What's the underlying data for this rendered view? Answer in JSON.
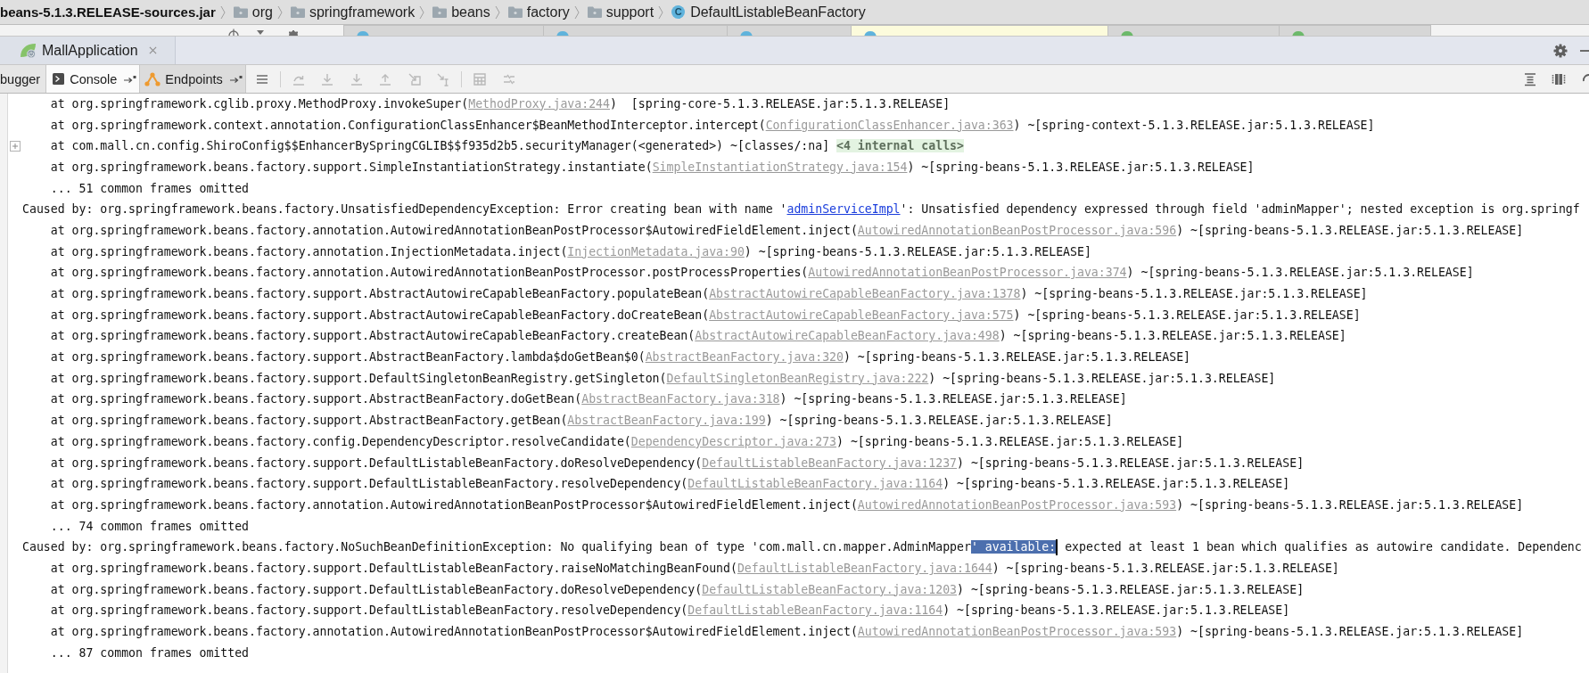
{
  "breadcrumb": {
    "items": [
      {
        "kind": "jar",
        "label": "beans-5.1.3.RELEASE-sources.jar"
      },
      {
        "kind": "folder",
        "label": "org"
      },
      {
        "kind": "folder",
        "label": "springframework"
      },
      {
        "kind": "folder",
        "label": "beans"
      },
      {
        "kind": "folder",
        "label": "factory"
      },
      {
        "kind": "folder",
        "label": "support"
      },
      {
        "kind": "class",
        "icon_letter": "C",
        "label": "DefaultListableBeanFactory"
      }
    ]
  },
  "editor_tabs": [
    {
      "selected": false,
      "color": "#5fb3dc"
    },
    {
      "selected": false,
      "color": "#5fb3dc"
    },
    {
      "selected": false,
      "color": "#5fb3dc"
    },
    {
      "selected": true,
      "color": "#5fb3dc"
    },
    {
      "selected": false,
      "color": "#6cb96a"
    },
    {
      "selected": false,
      "color": "#6cb96a"
    }
  ],
  "run_panel": {
    "tab": {
      "label": "MallApplication"
    }
  },
  "tool_tabs": [
    {
      "kind": "cut",
      "label": "bugger",
      "selected": false
    },
    {
      "kind": "console",
      "label": "Console",
      "selected": true
    },
    {
      "kind": "endpoints",
      "label": "Endpoints",
      "selected": false
    }
  ],
  "toolbar_groups": [
    [
      {
        "kind": "menu",
        "disabled": false
      }
    ],
    [
      {
        "kind": "curved_arrow",
        "disabled": true
      },
      {
        "kind": "down_arrow",
        "disabled": true
      },
      {
        "kind": "down_arrow",
        "disabled": true
      },
      {
        "kind": "up_arrow",
        "disabled": true
      },
      {
        "kind": "arrow_box",
        "disabled": true
      },
      {
        "kind": "arrow_cursor",
        "disabled": true
      }
    ],
    [
      {
        "kind": "calculator",
        "disabled": true
      },
      {
        "kind": "sliders",
        "disabled": true
      }
    ]
  ],
  "console": {
    "lines": [
      {
        "kind": "frame",
        "folded": false,
        "segments": [
          {
            "kind": "text",
            "text": "at org.springframework.cglib.proxy.MethodProxy.invokeSuper("
          },
          {
            "kind": "source_link",
            "text": "MethodProxy.java:244"
          },
          {
            "kind": "text",
            "text": ")  [spring-core-5.1.3.RELEASE.jar:5.1.3.RELEASE]"
          }
        ]
      },
      {
        "kind": "frame",
        "folded": false,
        "segments": [
          {
            "kind": "text",
            "text": "at org.springframework.context.annotation.ConfigurationClassEnhancer$BeanMethodInterceptor.intercept("
          },
          {
            "kind": "source_link",
            "text": "ConfigurationClassEnhancer.java:363"
          },
          {
            "kind": "text",
            "text": ") ~[spring-context-5.1.3.RELEASE.jar:5.1.3.RELEASE]"
          }
        ]
      },
      {
        "kind": "frame",
        "folded": true,
        "segments": [
          {
            "kind": "text",
            "text": "at com.mall.cn.config.ShiroConfig$$EnhancerBySpringCGLIB$$f935d2b5.securityManager(<generated>) ~[classes/:na] "
          },
          {
            "kind": "internal_calls",
            "text": "<4 internal calls>"
          }
        ]
      },
      {
        "kind": "frame",
        "folded": false,
        "segments": [
          {
            "kind": "text",
            "text": "at org.springframework.beans.factory.support.SimpleInstantiationStrategy.instantiate("
          },
          {
            "kind": "source_link",
            "text": "SimpleInstantiationStrategy.java:154"
          },
          {
            "kind": "text",
            "text": ") ~[spring-beans-5.1.3.RELEASE.jar:5.1.3.RELEASE]"
          }
        ]
      },
      {
        "kind": "omitted",
        "folded": false,
        "segments": [
          {
            "kind": "text",
            "text": "... 51 common frames omitted"
          }
        ]
      },
      {
        "kind": "caused_by",
        "folded": false,
        "segments": [
          {
            "kind": "text",
            "text": "Caused by: org.springframework.beans.factory.UnsatisfiedDependencyException: Error creating bean with name '"
          },
          {
            "kind": "bean_link",
            "text": "adminServiceImpl"
          },
          {
            "kind": "text",
            "text": "': Unsatisfied dependency expressed through field 'adminMapper'; nested exception is org.springf"
          }
        ]
      },
      {
        "kind": "frame",
        "folded": false,
        "segments": [
          {
            "kind": "text",
            "text": "at org.springframework.beans.factory.annotation.AutowiredAnnotationBeanPostProcessor$AutowiredFieldElement.inject("
          },
          {
            "kind": "source_link",
            "text": "AutowiredAnnotationBeanPostProcessor.java:596"
          },
          {
            "kind": "text",
            "text": ") ~[spring-beans-5.1.3.RELEASE.jar:5.1.3.RELEASE]"
          }
        ]
      },
      {
        "kind": "frame",
        "folded": false,
        "segments": [
          {
            "kind": "text",
            "text": "at org.springframework.beans.factory.annotation.InjectionMetadata.inject("
          },
          {
            "kind": "source_link",
            "text": "InjectionMetadata.java:90"
          },
          {
            "kind": "text",
            "text": ") ~[spring-beans-5.1.3.RELEASE.jar:5.1.3.RELEASE]"
          }
        ]
      },
      {
        "kind": "frame",
        "folded": false,
        "segments": [
          {
            "kind": "text",
            "text": "at org.springframework.beans.factory.annotation.AutowiredAnnotationBeanPostProcessor.postProcessProperties("
          },
          {
            "kind": "source_link",
            "text": "AutowiredAnnotationBeanPostProcessor.java:374"
          },
          {
            "kind": "text",
            "text": ") ~[spring-beans-5.1.3.RELEASE.jar:5.1.3.RELEASE]"
          }
        ]
      },
      {
        "kind": "frame",
        "folded": false,
        "segments": [
          {
            "kind": "text",
            "text": "at org.springframework.beans.factory.support.AbstractAutowireCapableBeanFactory.populateBean("
          },
          {
            "kind": "source_link",
            "text": "AbstractAutowireCapableBeanFactory.java:1378"
          },
          {
            "kind": "text",
            "text": ") ~[spring-beans-5.1.3.RELEASE.jar:5.1.3.RELEASE]"
          }
        ]
      },
      {
        "kind": "frame",
        "folded": false,
        "segments": [
          {
            "kind": "text",
            "text": "at org.springframework.beans.factory.support.AbstractAutowireCapableBeanFactory.doCreateBean("
          },
          {
            "kind": "source_link",
            "text": "AbstractAutowireCapableBeanFactory.java:575"
          },
          {
            "kind": "text",
            "text": ") ~[spring-beans-5.1.3.RELEASE.jar:5.1.3.RELEASE]"
          }
        ]
      },
      {
        "kind": "frame",
        "folded": false,
        "segments": [
          {
            "kind": "text",
            "text": "at org.springframework.beans.factory.support.AbstractAutowireCapableBeanFactory.createBean("
          },
          {
            "kind": "source_link",
            "text": "AbstractAutowireCapableBeanFactory.java:498"
          },
          {
            "kind": "text",
            "text": ") ~[spring-beans-5.1.3.RELEASE.jar:5.1.3.RELEASE]"
          }
        ]
      },
      {
        "kind": "frame",
        "folded": false,
        "segments": [
          {
            "kind": "text",
            "text": "at org.springframework.beans.factory.support.AbstractBeanFactory.lambda$doGetBean$0("
          },
          {
            "kind": "source_link",
            "text": "AbstractBeanFactory.java:320"
          },
          {
            "kind": "text",
            "text": ") ~[spring-beans-5.1.3.RELEASE.jar:5.1.3.RELEASE]"
          }
        ]
      },
      {
        "kind": "frame",
        "folded": false,
        "segments": [
          {
            "kind": "text",
            "text": "at org.springframework.beans.factory.support.DefaultSingletonBeanRegistry.getSingleton("
          },
          {
            "kind": "source_link",
            "text": "DefaultSingletonBeanRegistry.java:222"
          },
          {
            "kind": "text",
            "text": ") ~[spring-beans-5.1.3.RELEASE.jar:5.1.3.RELEASE]"
          }
        ]
      },
      {
        "kind": "frame",
        "folded": false,
        "segments": [
          {
            "kind": "text",
            "text": "at org.springframework.beans.factory.support.AbstractBeanFactory.doGetBean("
          },
          {
            "kind": "source_link",
            "text": "AbstractBeanFactory.java:318"
          },
          {
            "kind": "text",
            "text": ") ~[spring-beans-5.1.3.RELEASE.jar:5.1.3.RELEASE]"
          }
        ]
      },
      {
        "kind": "frame",
        "folded": false,
        "segments": [
          {
            "kind": "text",
            "text": "at org.springframework.beans.factory.support.AbstractBeanFactory.getBean("
          },
          {
            "kind": "source_link",
            "text": "AbstractBeanFactory.java:199"
          },
          {
            "kind": "text",
            "text": ") ~[spring-beans-5.1.3.RELEASE.jar:5.1.3.RELEASE]"
          }
        ]
      },
      {
        "kind": "frame",
        "folded": false,
        "segments": [
          {
            "kind": "text",
            "text": "at org.springframework.beans.factory.config.DependencyDescriptor.resolveCandidate("
          },
          {
            "kind": "source_link",
            "text": "DependencyDescriptor.java:273"
          },
          {
            "kind": "text",
            "text": ") ~[spring-beans-5.1.3.RELEASE.jar:5.1.3.RELEASE]"
          }
        ]
      },
      {
        "kind": "frame",
        "folded": false,
        "segments": [
          {
            "kind": "text",
            "text": "at org.springframework.beans.factory.support.DefaultListableBeanFactory.doResolveDependency("
          },
          {
            "kind": "source_link",
            "text": "DefaultListableBeanFactory.java:1237"
          },
          {
            "kind": "text",
            "text": ") ~[spring-beans-5.1.3.RELEASE.jar:5.1.3.RELEASE]"
          }
        ]
      },
      {
        "kind": "frame",
        "folded": false,
        "segments": [
          {
            "kind": "text",
            "text": "at org.springframework.beans.factory.support.DefaultListableBeanFactory.resolveDependency("
          },
          {
            "kind": "source_link",
            "text": "DefaultListableBeanFactory.java:1164"
          },
          {
            "kind": "text",
            "text": ") ~[spring-beans-5.1.3.RELEASE.jar:5.1.3.RELEASE]"
          }
        ]
      },
      {
        "kind": "frame",
        "folded": false,
        "segments": [
          {
            "kind": "text",
            "text": "at org.springframework.beans.factory.annotation.AutowiredAnnotationBeanPostProcessor$AutowiredFieldElement.inject("
          },
          {
            "kind": "source_link",
            "text": "AutowiredAnnotationBeanPostProcessor.java:593"
          },
          {
            "kind": "text",
            "text": ") ~[spring-beans-5.1.3.RELEASE.jar:5.1.3.RELEASE]"
          }
        ]
      },
      {
        "kind": "omitted",
        "folded": false,
        "segments": [
          {
            "kind": "text",
            "text": "... 74 common frames omitted"
          }
        ]
      },
      {
        "kind": "caused_by",
        "folded": false,
        "segments": [
          {
            "kind": "text",
            "text": "Caused by: org.springframework.beans.factory.NoSuchBeanDefinitionException: No qualifying bean of type 'com.mall.cn.mapper.AdminMapper"
          },
          {
            "kind": "selection",
            "text": "' available:"
          },
          {
            "kind": "caret"
          },
          {
            "kind": "text",
            "text": " expected at least 1 bean which qualifies as autowire candidate. Dependenc"
          }
        ]
      },
      {
        "kind": "frame",
        "folded": false,
        "segments": [
          {
            "kind": "text",
            "text": "at org.springframework.beans.factory.support.DefaultListableBeanFactory.raiseNoMatchingBeanFound("
          },
          {
            "kind": "source_link",
            "text": "DefaultListableBeanFactory.java:1644"
          },
          {
            "kind": "text",
            "text": ") ~[spring-beans-5.1.3.RELEASE.jar:5.1.3.RELEASE]"
          }
        ]
      },
      {
        "kind": "frame",
        "folded": false,
        "segments": [
          {
            "kind": "text",
            "text": "at org.springframework.beans.factory.support.DefaultListableBeanFactory.doResolveDependency("
          },
          {
            "kind": "source_link",
            "text": "DefaultListableBeanFactory.java:1203"
          },
          {
            "kind": "text",
            "text": ") ~[spring-beans-5.1.3.RELEASE.jar:5.1.3.RELEASE]"
          }
        ]
      },
      {
        "kind": "frame",
        "folded": false,
        "segments": [
          {
            "kind": "text",
            "text": "at org.springframework.beans.factory.support.DefaultListableBeanFactory.resolveDependency("
          },
          {
            "kind": "source_link",
            "text": "DefaultListableBeanFactory.java:1164"
          },
          {
            "kind": "text",
            "text": ") ~[spring-beans-5.1.3.RELEASE.jar:5.1.3.RELEASE]"
          }
        ]
      },
      {
        "kind": "frame",
        "folded": false,
        "segments": [
          {
            "kind": "text",
            "text": "at org.springframework.beans.factory.annotation.AutowiredAnnotationBeanPostProcessor$AutowiredFieldElement.inject("
          },
          {
            "kind": "source_link",
            "text": "AutowiredAnnotationBeanPostProcessor.java:593"
          },
          {
            "kind": "text",
            "text": ") ~[spring-beans-5.1.3.RELEASE.jar:5.1.3.RELEASE]"
          }
        ]
      },
      {
        "kind": "omitted",
        "folded": false,
        "segments": [
          {
            "kind": "text",
            "text": "... 87 common frames omitted"
          }
        ]
      }
    ]
  }
}
